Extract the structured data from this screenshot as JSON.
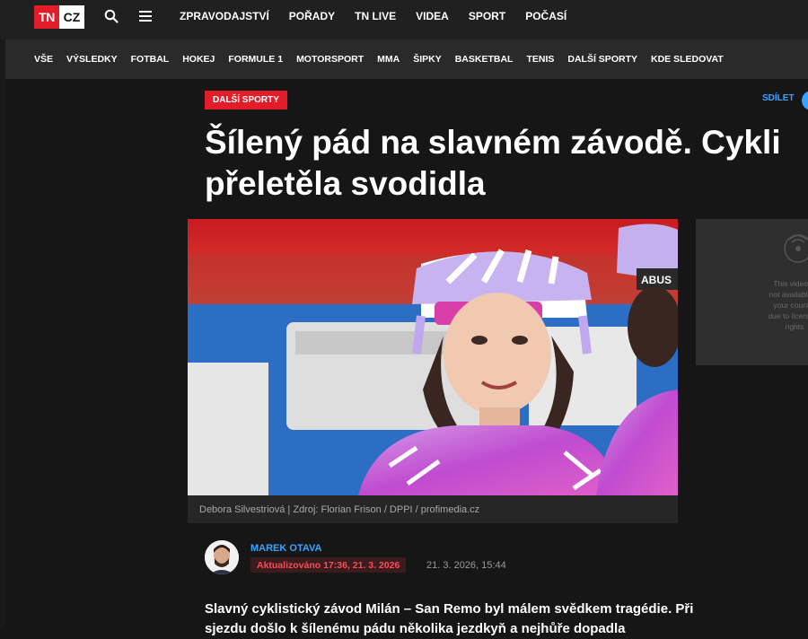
{
  "header": {
    "logo_left": "TN",
    "logo_right": "CZ",
    "nav": [
      "ZPRAVODAJSTVÍ",
      "POŘADY",
      "TN LIVE",
      "VIDEA",
      "SPORT",
      "POČASÍ"
    ]
  },
  "categories": [
    "VŠE",
    "VÝSLEDKY",
    "FOTBAL",
    "HOKEJ",
    "FORMULE 1",
    "MOTORSPORT",
    "MMA",
    "ŠIPKY",
    "BASKETBAL",
    "TENIS",
    "DALŠÍ SPORTY",
    "KDE SLEDOVAT"
  ],
  "article": {
    "tag": "DALŠÍ SPORTY",
    "share_label": "SDÍLET",
    "title_line1": "Šílený pád na slavném závodě. Cykli",
    "title_line2": "přeletěla svodidla",
    "photo_caption": "Debora Silvestriová | Zdroj: Florian Frison / DPPI / profimedia.cz",
    "jersey_text": "ABUS",
    "video_notice": "This video is not available in your country due to licensing rights",
    "author": "MAREK OTAVA",
    "updated": "Aktualizováno 17:36, 21. 3. 2026",
    "published": "21. 3. 2026, 15:44",
    "lead": "Slavný cyklistický závod Milán – San Remo byl málem svědkem tragédie. Při sjezdu došlo k šílenému pádu několika jezdkyň a nejhůře dopadla"
  },
  "colors": {
    "brand_red": "#e21d2a",
    "link_blue": "#3aa3ff",
    "background": "#161616"
  }
}
